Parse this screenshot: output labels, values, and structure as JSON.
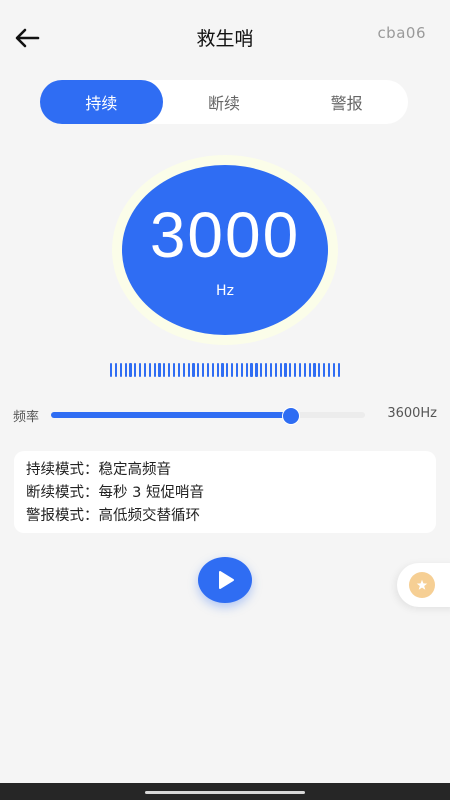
{
  "header": {
    "back_icon": "arrow-left-icon",
    "title": "救生哨",
    "tag": "cba06"
  },
  "tabs": [
    {
      "label": "持续",
      "active": true
    },
    {
      "label": "断续",
      "active": false
    },
    {
      "label": "警报",
      "active": false
    }
  ],
  "display": {
    "frequency": "3000",
    "unit": "Hz"
  },
  "slider": {
    "label": "频率",
    "value_fraction": 0.76,
    "max_label": "3600Hz"
  },
  "info": {
    "lines": [
      "持续模式：稳定高频音",
      "断续模式：每秒 3 短促哨音",
      "警报模式：高低频交替循环"
    ]
  },
  "controls": {
    "play_icon": "play-icon",
    "float_icon": "star-coin-icon"
  },
  "colors": {
    "accent": "#2f6df3",
    "background": "#f5f5f5"
  }
}
